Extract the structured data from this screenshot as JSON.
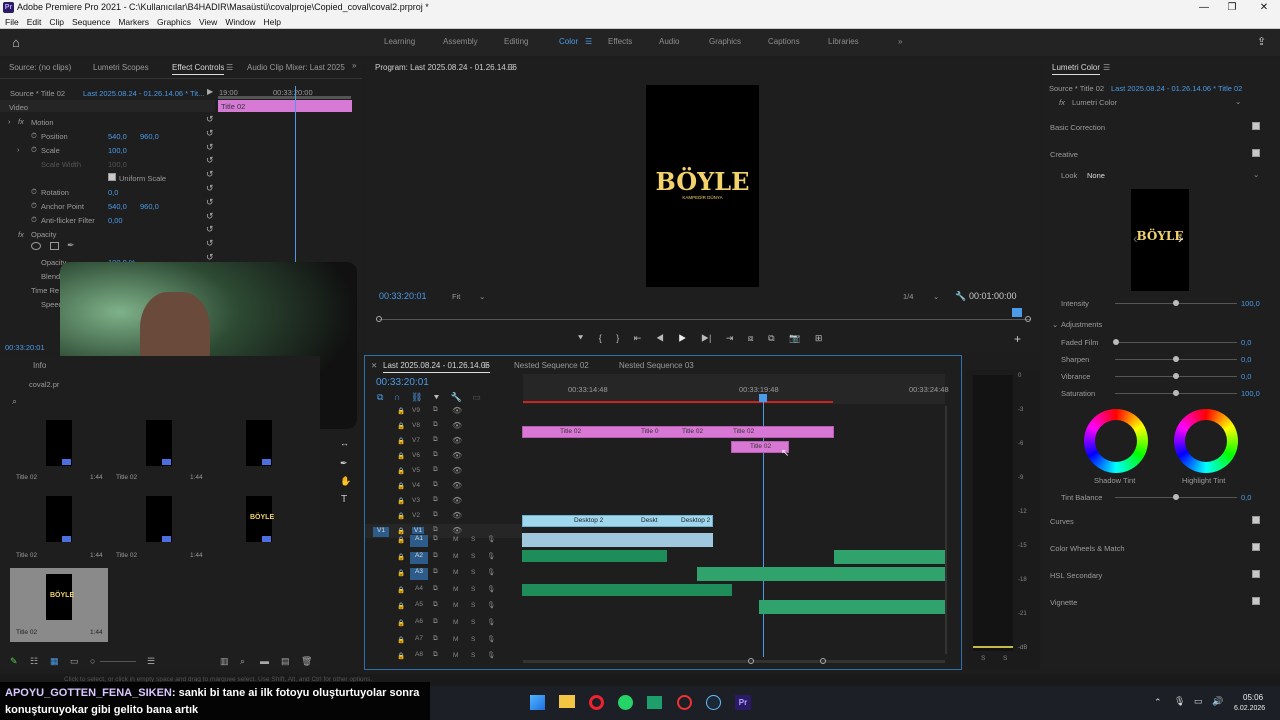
{
  "window": {
    "title": "Adobe Premiere Pro 2021 - C:\\Kullanıcılar\\B4HADIR\\Masaüstü\\covalproje\\Copied_coval\\coval2.prproj *",
    "logo": "Pr"
  },
  "menu": [
    "File",
    "Edit",
    "Clip",
    "Sequence",
    "Markers",
    "Graphics",
    "View",
    "Window",
    "Help"
  ],
  "workspaces": [
    "Learning",
    "Assembly",
    "Editing",
    "Color",
    "Effects",
    "Audio",
    "Graphics",
    "Captions",
    "Libraries"
  ],
  "active_workspace": "Color",
  "source_panel": {
    "tabs": [
      "Source: (no clips)",
      "Lumetri Scopes",
      "Effect Controls",
      "Audio Clip Mixer: Last 2025"
    ],
    "source_label": "Source * Title 02",
    "seq_label": "Last 2025.08.24 - 01.26.14.06 * Tit...",
    "time_start": "19:00",
    "time_mid": "00:33:20:00",
    "clip_label": "Title 02",
    "video": "Video",
    "motion": "Motion",
    "position_label": "Position",
    "position_x": "540,0",
    "position_y": "960,0",
    "scale_label": "Scale",
    "scale": "100,0",
    "scale_width_label": "Scale Width",
    "scale_width": "100,0",
    "uniform_scale": "Uniform Scale",
    "rotation_label": "Rotation",
    "rotation": "0,0",
    "anchor_label": "Anchor Point",
    "anchor_x": "540,0",
    "anchor_y": "960,0",
    "antiflicker_label": "Anti-flicker Filter",
    "antiflicker": "0,00",
    "opacity_section": "Opacity",
    "opacity_label": "Opacity",
    "opacity": "100,0 %",
    "blend": "Blend",
    "time_remap": "Time Re",
    "speed": "Speed",
    "timecode": "00:33:20:01"
  },
  "program": {
    "title": "Program: Last 2025.08.24 - 01.26.14.06",
    "timecode": "00:33:20:01",
    "fit": "Fit",
    "quality": "1/4",
    "duration": "00:01:00:00",
    "video_text": "BÖYLE",
    "video_sub": "KAMPEDİR DÜNYA"
  },
  "project": {
    "tab": "Info",
    "name": "coval2.pr",
    "items": [
      {
        "label": "Title 02",
        "dur": ""
      },
      {
        "label": "Title 02",
        "dur": "1:44"
      },
      {
        "label": "",
        "dur": "1:44"
      },
      {
        "label": "Title 02",
        "dur": ""
      },
      {
        "label": "Title 02",
        "dur": "1:44"
      },
      {
        "label": "",
        "dur": "1:44"
      },
      {
        "label": "Title 02",
        "dur": "1:44"
      }
    ]
  },
  "timeline": {
    "tabs": [
      "Last 2025.08.24 - 01.26.14.06",
      "Nested Sequence 02",
      "Nested Sequence 03"
    ],
    "timecode": "00:33:20:01",
    "ruler": [
      "00:33:14:48",
      "00:33:19:48",
      "00:33:24:48"
    ],
    "video_tracks": [
      "V9",
      "V8",
      "V7",
      "V6",
      "V5",
      "V4",
      "V3",
      "V2",
      "V1"
    ],
    "audio_tracks": [
      "A1",
      "A2",
      "A3",
      "A4",
      "A5",
      "A6",
      "A7",
      "A8"
    ],
    "v7_clips": [
      "Title 02",
      "Title 0",
      "Title 02",
      "Title 02"
    ],
    "v6_clip": "Title 02",
    "v1_clips": [
      "Desktop 2",
      "Deskt",
      "Desktop 2"
    ],
    "mute": "M",
    "solo": "S",
    "meter_scale": [
      "0",
      "-3",
      "-6",
      "-9",
      "-12",
      "-15",
      "-18",
      "-21",
      "-dB"
    ],
    "meter_ls": "S",
    "meter_rs": "S"
  },
  "lumetri": {
    "title": "Lumetri Color",
    "source": "Source * Title 02",
    "seq": "Last 2025.08.24 - 01.26.14.06 * Title 02",
    "effect": "Lumetri Color",
    "basic": "Basic Correction",
    "creative": "Creative",
    "look_label": "Look",
    "look_value": "None",
    "preview_text": "BÖYLE",
    "intensity_label": "Intensity",
    "intensity": "100,0",
    "adjustments": "Adjustments",
    "faded_label": "Faded Film",
    "faded": "0,0",
    "sharpen_label": "Sharpen",
    "sharpen": "0,0",
    "vibrance_label": "Vibrance",
    "vibrance": "0,0",
    "saturation_label": "Saturation",
    "saturation": "100,0",
    "shadow_tint": "Shadow Tint",
    "highlight_tint": "Highlight Tint",
    "tint_balance_label": "Tint Balance",
    "tint_balance": "0,0",
    "curves": "Curves",
    "wheels": "Color Wheels & Match",
    "hsl": "HSL Secondary",
    "vignette": "Vignette"
  },
  "status": "Click to select, or click in empty space and drag to marquee select. Use Shift, Alt, and Ctrl for other options.",
  "chat": {
    "user": "APOYU_GOTTEN_FENA_SIKEN",
    "message": ": sanki bi tane ai ilk fotoyu oluşturtuyolar sonra konuşturuyokar gibi gelito bana artık"
  },
  "taskbar": {
    "time": "05:06",
    "date": "6.02.2026",
    "pr_label": "Pr"
  },
  "colors": {
    "accent": "#4c9be8",
    "video_clip": "#d878d4",
    "desktop_clip": "#9fd7ee",
    "audio_clip": "#1f8d5a",
    "text_yellow": "#f2d36b"
  }
}
